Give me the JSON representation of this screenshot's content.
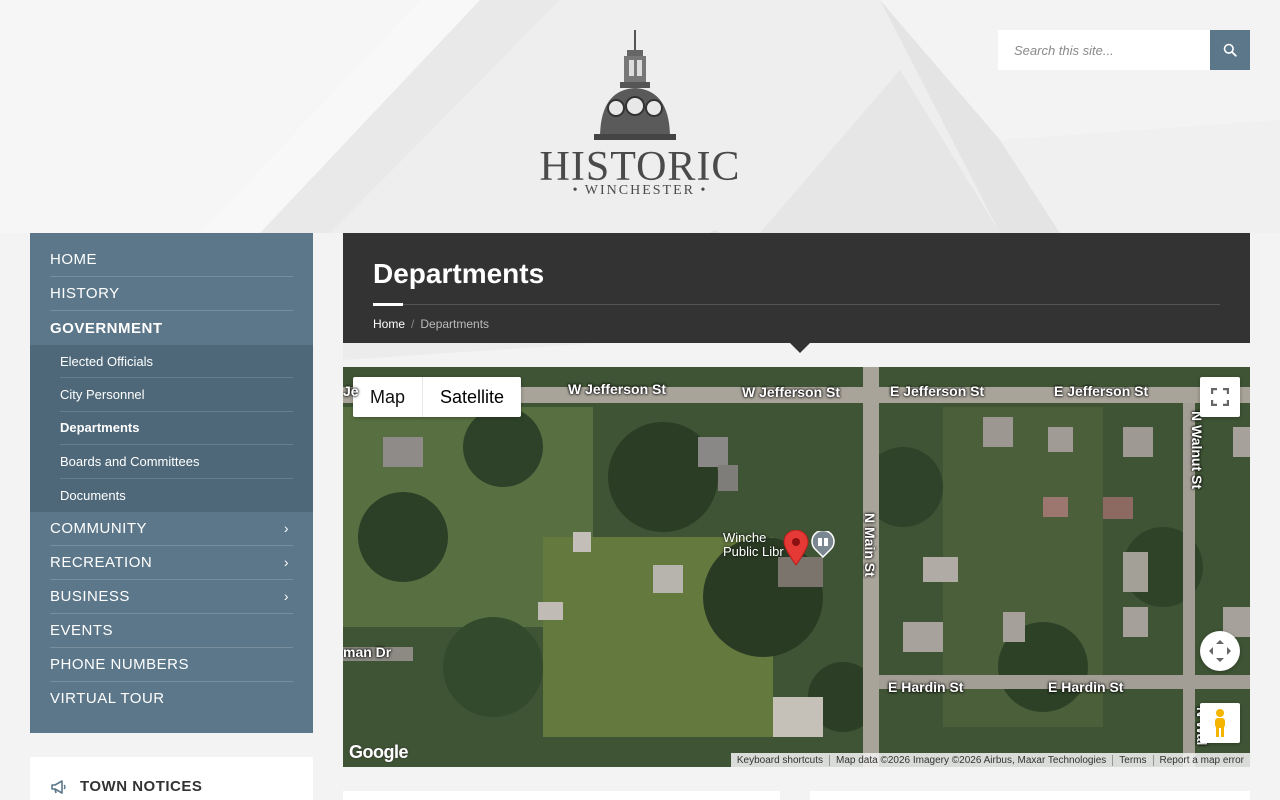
{
  "site": {
    "logo_title": "HISTORIC",
    "logo_subtitle": "• WINCHESTER •"
  },
  "search": {
    "placeholder": "Search this site..."
  },
  "sidebar": {
    "items": [
      {
        "label": "HOME",
        "has_children": false
      },
      {
        "label": "HISTORY",
        "has_children": false
      },
      {
        "label": "GOVERNMENT",
        "has_children": false,
        "active": true
      },
      {
        "label": "COMMUNITY",
        "has_children": true
      },
      {
        "label": "RECREATION",
        "has_children": true
      },
      {
        "label": "BUSINESS",
        "has_children": true
      },
      {
        "label": "EVENTS",
        "has_children": false
      },
      {
        "label": "PHONE NUMBERS",
        "has_children": false
      },
      {
        "label": "VIRTUAL TOUR",
        "has_children": false
      }
    ],
    "government_sub": [
      {
        "label": "Elected Officials"
      },
      {
        "label": "City Personnel"
      },
      {
        "label": "Departments",
        "active": true
      },
      {
        "label": "Boards and Committees"
      },
      {
        "label": "Documents"
      }
    ],
    "notices_title": "TOWN NOTICES"
  },
  "page": {
    "title": "Departments",
    "breadcrumb": [
      {
        "label": "Home"
      },
      {
        "label": "Departments"
      }
    ]
  },
  "map": {
    "type_buttons": [
      "Map",
      "Satellite"
    ],
    "selected_type": "Satellite",
    "streets": {
      "w_jefferson_1": "W Jefferson St",
      "w_jefferson_2": "W Jefferson St",
      "e_jefferson_1": "E Jefferson St",
      "e_jefferson_2": "E Jefferson St",
      "n_main": "N Main St",
      "n_walnut": "N Walnut St",
      "n_walnut_2": "N Wal",
      "e_hardin_1": "E Hardin St",
      "e_hardin_2": "E Hardin St",
      "man_dr": "man Dr",
      "je": "Je"
    },
    "place": "Winchester\nPublic Library",
    "place_line1": "Winche",
    "place_line2": "Public Libr",
    "google": "Google",
    "attribution": [
      "Keyboard shortcuts",
      "Map data ©2026 Imagery ©2026 Airbus, Maxar Technologies",
      "Terms",
      "Report a map error"
    ],
    "colors": {
      "pin": "#e53935",
      "satellite_base": "#3e5236"
    }
  },
  "colors": {
    "sidebar": "#5c7789",
    "sidebar_sub": "#4e6879",
    "header_dark": "#333333",
    "search_button": "#5b7789"
  }
}
